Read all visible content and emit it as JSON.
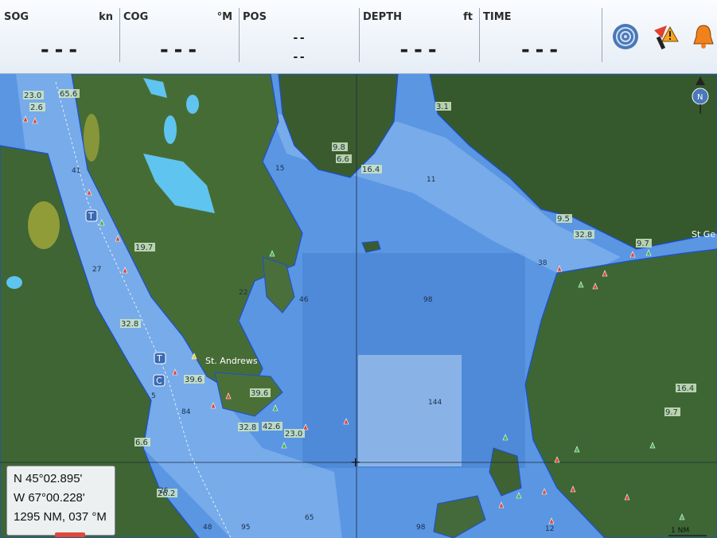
{
  "databar": {
    "sog": {
      "label": "SOG",
      "unit": "kn",
      "value": "---"
    },
    "cog": {
      "label": "COG",
      "unit": "°M",
      "value": "---"
    },
    "pos": {
      "label": "POS",
      "line1": "--",
      "line2": "--"
    },
    "depth": {
      "label": "DEPTH",
      "unit": "ft",
      "value": "---"
    },
    "time": {
      "label": "TIME",
      "value": "---"
    }
  },
  "icons": [
    "radar-icon",
    "alarm-warning-icon",
    "alarm-bell-icon",
    "north-up-compass-icon"
  ],
  "colors": {
    "deep": "#4f8fe0",
    "shallow": "#9cc8f2",
    "land": "#3b5e30",
    "contour": "#1b4fd6",
    "lake": "#5fc4ef"
  },
  "map": {
    "place_names": [
      "St. Andrews",
      "St Ge"
    ],
    "depth_labels": [
      "23.0",
      "65.6",
      "2.6",
      "41",
      "19.7",
      "27",
      "32.8",
      "39.6",
      "6.6",
      "26.2",
      "9.8",
      "6.6",
      "16.4",
      "3.1",
      "9.5",
      "32.8",
      "9.7",
      "38",
      "22",
      "46",
      "98",
      "144",
      "39.6",
      "32.8",
      "42.6",
      "23.0",
      "16.4",
      "9.7",
      "65",
      "95",
      "48",
      "98",
      "84",
      "5",
      "11",
      "15",
      "26",
      "12"
    ],
    "markers": [
      "T",
      "T",
      "C"
    ],
    "scale": "1 NM"
  },
  "readout": {
    "lat": "N 45°02.895'",
    "lon": "W 67°00.228'",
    "range": "1295 NM, 037 °M"
  }
}
